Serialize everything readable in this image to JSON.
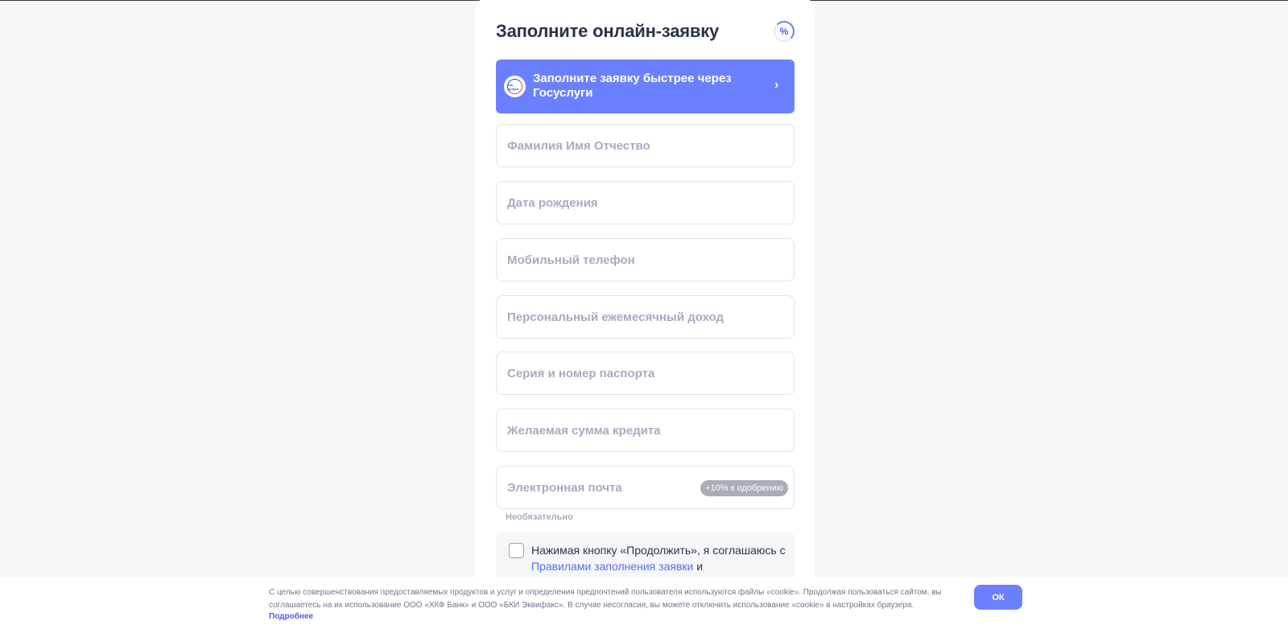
{
  "form": {
    "title": "Заполните онлайн-заявку",
    "percent_symbol": "%",
    "gosuslugi": {
      "logo_text": "гос услуги",
      "label": "Заполните заявку быстрее через Госуслуги",
      "chevron": "›"
    },
    "fields": [
      {
        "placeholder": "Фамилия Имя Отчество",
        "value": ""
      },
      {
        "placeholder": "Дата рождения",
        "value": ""
      },
      {
        "placeholder": "Мобильный телефон",
        "value": ""
      },
      {
        "placeholder": "Персональный ежемесячный доход",
        "value": ""
      },
      {
        "placeholder": "Серия и номер паспорта",
        "value": ""
      },
      {
        "placeholder": "Желаемая сумма кредита",
        "value": ""
      },
      {
        "placeholder": "Электронная почта",
        "value": ""
      }
    ],
    "email_bonus": "+10% к одобрению",
    "email_optional": "Необязательно",
    "consent": {
      "text_before": "Нажимая кнопку «Продолжить», я соглашаюсь с ",
      "link": "Правилами заполнения заявки",
      "text_after": " и присоединяюсь"
    }
  },
  "cookie": {
    "text": "С целью совершенствования предоставляемых продуктов и услуг и определения предпочтений пользователя используются файлы «cookie». Продолжая пользоваться сайтом, вы соглашаетесь на их использование ООО «ХКФ Банк» и ООО «БКИ Эквифакс». В случае несогласия, вы можете отключить использование «cookie» в настройках браузера.",
    "more_link": "Подробнее",
    "ok_label": "ОК"
  },
  "colors": {
    "accent": "#6b80ff",
    "link": "#5a6cf5",
    "background": "#f5f6f8"
  }
}
